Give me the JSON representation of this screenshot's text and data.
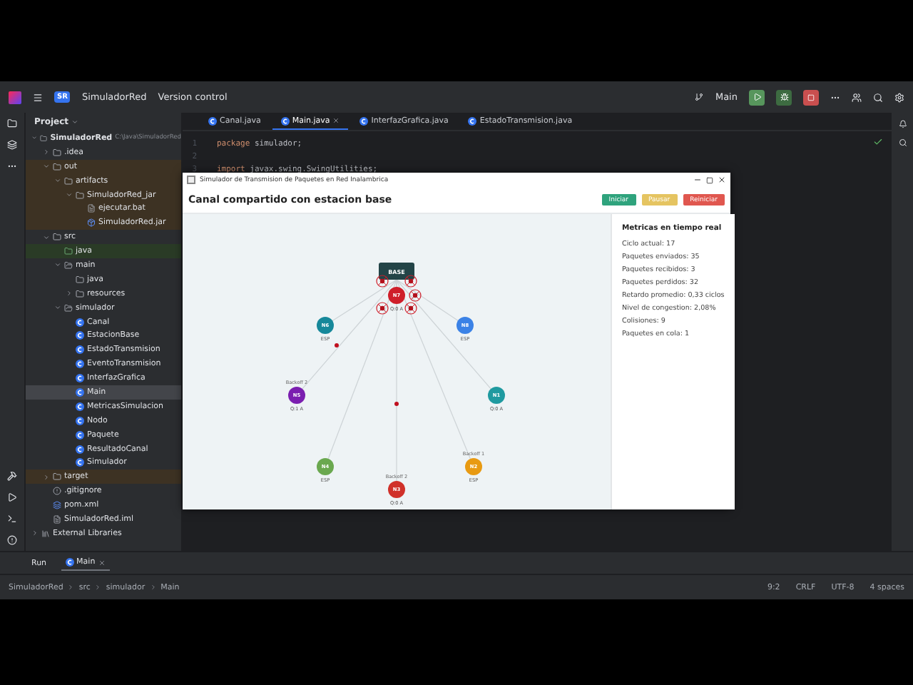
{
  "title_bar": {
    "project_badge": "SR",
    "project": "SimuladorRed",
    "vcs": "Version control",
    "branch": "Main"
  },
  "project_panel": {
    "title": "Project",
    "tree": [
      {
        "label": "SimuladorRed",
        "path": "C:\\Java\\SimuladorRed",
        "kind": "module",
        "expanded": true,
        "selected": false,
        "excluded": false,
        "children": [
          {
            "label": ".idea",
            "kind": "folder",
            "expanded": false,
            "selected": false,
            "excluded": false
          },
          {
            "label": "out",
            "kind": "folder",
            "expanded": true,
            "selected": false,
            "excluded": true,
            "children": [
              {
                "label": "artifacts",
                "kind": "folder",
                "expanded": true,
                "selected": false,
                "excluded": true,
                "children": [
                  {
                    "label": "SimuladorRed_jar",
                    "kind": "folder",
                    "expanded": true,
                    "selected": false,
                    "excluded": true,
                    "children": [
                      {
                        "label": "ejecutar.bat",
                        "kind": "text",
                        "selected": false,
                        "excluded": true
                      },
                      {
                        "label": "SimuladorRed.jar",
                        "kind": "jar",
                        "selected": false,
                        "excluded": true
                      }
                    ]
                  }
                ]
              }
            ]
          },
          {
            "label": "src",
            "kind": "folder",
            "expanded": true,
            "selected": false,
            "excluded": false,
            "children": [
              {
                "label": "java",
                "kind": "source",
                "selected": false,
                "excluded": false
              },
              {
                "label": "main",
                "kind": "package",
                "expanded": true,
                "selected": false,
                "excluded": false,
                "children": [
                  {
                    "label": "java",
                    "kind": "folder",
                    "selected": false,
                    "excluded": false
                  },
                  {
                    "label": "resources",
                    "kind": "folder",
                    "expanded": false,
                    "selected": false,
                    "excluded": false
                  }
                ]
              },
              {
                "label": "simulador",
                "kind": "package",
                "expanded": true,
                "selected": false,
                "excluded": false,
                "children": [
                  {
                    "label": "Canal",
                    "kind": "class",
                    "selected": false,
                    "excluded": false
                  },
                  {
                    "label": "EstacionBase",
                    "kind": "class",
                    "selected": false,
                    "excluded": false
                  },
                  {
                    "label": "EstadoTransmision",
                    "kind": "class",
                    "selected": false,
                    "excluded": false
                  },
                  {
                    "label": "EventoTransmision",
                    "kind": "class",
                    "selected": false,
                    "excluded": false
                  },
                  {
                    "label": "InterfazGrafica",
                    "kind": "class",
                    "selected": false,
                    "excluded": false
                  },
                  {
                    "label": "Main",
                    "kind": "class",
                    "selected": true,
                    "excluded": false
                  },
                  {
                    "label": "MetricasSimulacion",
                    "kind": "class",
                    "selected": false,
                    "excluded": false
                  },
                  {
                    "label": "Nodo",
                    "kind": "class",
                    "selected": false,
                    "excluded": false
                  },
                  {
                    "label": "Paquete",
                    "kind": "class",
                    "selected": false,
                    "excluded": false
                  },
                  {
                    "label": "ResultadoCanal",
                    "kind": "class",
                    "selected": false,
                    "excluded": false
                  },
                  {
                    "label": "Simulador",
                    "kind": "class",
                    "selected": false,
                    "excluded": false
                  }
                ]
              }
            ]
          },
          {
            "label": "target",
            "kind": "folder",
            "expanded": false,
            "selected": false,
            "excluded": true
          },
          {
            "label": ".gitignore",
            "kind": "ignore",
            "selected": false,
            "excluded": false
          },
          {
            "label": "pom.xml",
            "kind": "maven",
            "selected": false,
            "excluded": false
          },
          {
            "label": "SimuladorRed.iml",
            "kind": "text",
            "selected": false,
            "excluded": false
          }
        ]
      },
      {
        "label": "External Libraries",
        "kind": "library",
        "expanded": false,
        "selected": false,
        "excluded": false
      }
    ]
  },
  "editor": {
    "tabs": [
      {
        "label": "Canal.java",
        "selected": false
      },
      {
        "label": "Main.java",
        "selected": true
      },
      {
        "label": "InterfazGrafica.java",
        "selected": false
      },
      {
        "label": "EstadoTransmision.java",
        "selected": false
      }
    ],
    "lines": [
      {
        "number": "1",
        "tokens": [
          {
            "kind": "keyword",
            "text": "package"
          },
          {
            "kind": "plain",
            "text": " simulador;"
          }
        ]
      },
      {
        "number": "2"
      },
      {
        "number": "3",
        "tokens": [
          {
            "kind": "keyword",
            "text": "import"
          },
          {
            "kind": "plain",
            "text": " javax.swing.SwingUtilities;"
          }
        ]
      }
    ]
  },
  "app_window": {
    "title": "Simulador de Transmision de Paquetes en Red Inalambrica",
    "heading": "Canal compartido con estacion base",
    "buttons": [
      {
        "label": "Iniciar",
        "color": "#2fa37d"
      },
      {
        "label": "Pausar",
        "color": "#e5c461"
      },
      {
        "label": "Reiniciar",
        "color": "#e0574f"
      }
    ],
    "base": "BASE",
    "nodes": [
      {
        "id": "N7",
        "color": "#cf1f2a",
        "below": "Q:0 A"
      },
      {
        "id": "N6",
        "color": "#16889a",
        "below": "ESP"
      },
      {
        "id": "N8",
        "color": "#3b82e6",
        "below": "ESP"
      },
      {
        "id": "N5",
        "color": "#7b1fb0",
        "above": "Backoff 2",
        "below": "Q:1 A"
      },
      {
        "id": "N1",
        "color": "#1f9aa0",
        "below": "Q:0 A"
      },
      {
        "id": "N4",
        "color": "#6aa84f",
        "below": "ESP"
      },
      {
        "id": "N2",
        "color": "#e89a12",
        "above": "Backoff 1",
        "below": "ESP"
      },
      {
        "id": "N3",
        "color": "#d0312a",
        "above": "Backoff 2",
        "below": "Q:0 A"
      }
    ],
    "metrics": {
      "title": "Metricas en tiempo real",
      "lines": [
        "Ciclo actual: 17",
        "Paquetes enviados: 35",
        "Paquetes recibidos: 3",
        "Paquetes perdidos: 32",
        "Retardo promedio: 0,33 ciclos",
        "Nivel de congestion: 2,08%",
        "Colisiones: 9",
        "Paquetes en cola: 1"
      ]
    }
  },
  "run_panel": {
    "label": "Run",
    "tabs": [
      {
        "label": "Main",
        "selected": true
      }
    ]
  },
  "status_bar": {
    "breadcrumbs": [
      "SimuladorRed",
      "src",
      "simulador",
      "Main"
    ],
    "items": [
      "9:2",
      "CRLF",
      "UTF-8",
      "4 spaces"
    ]
  }
}
